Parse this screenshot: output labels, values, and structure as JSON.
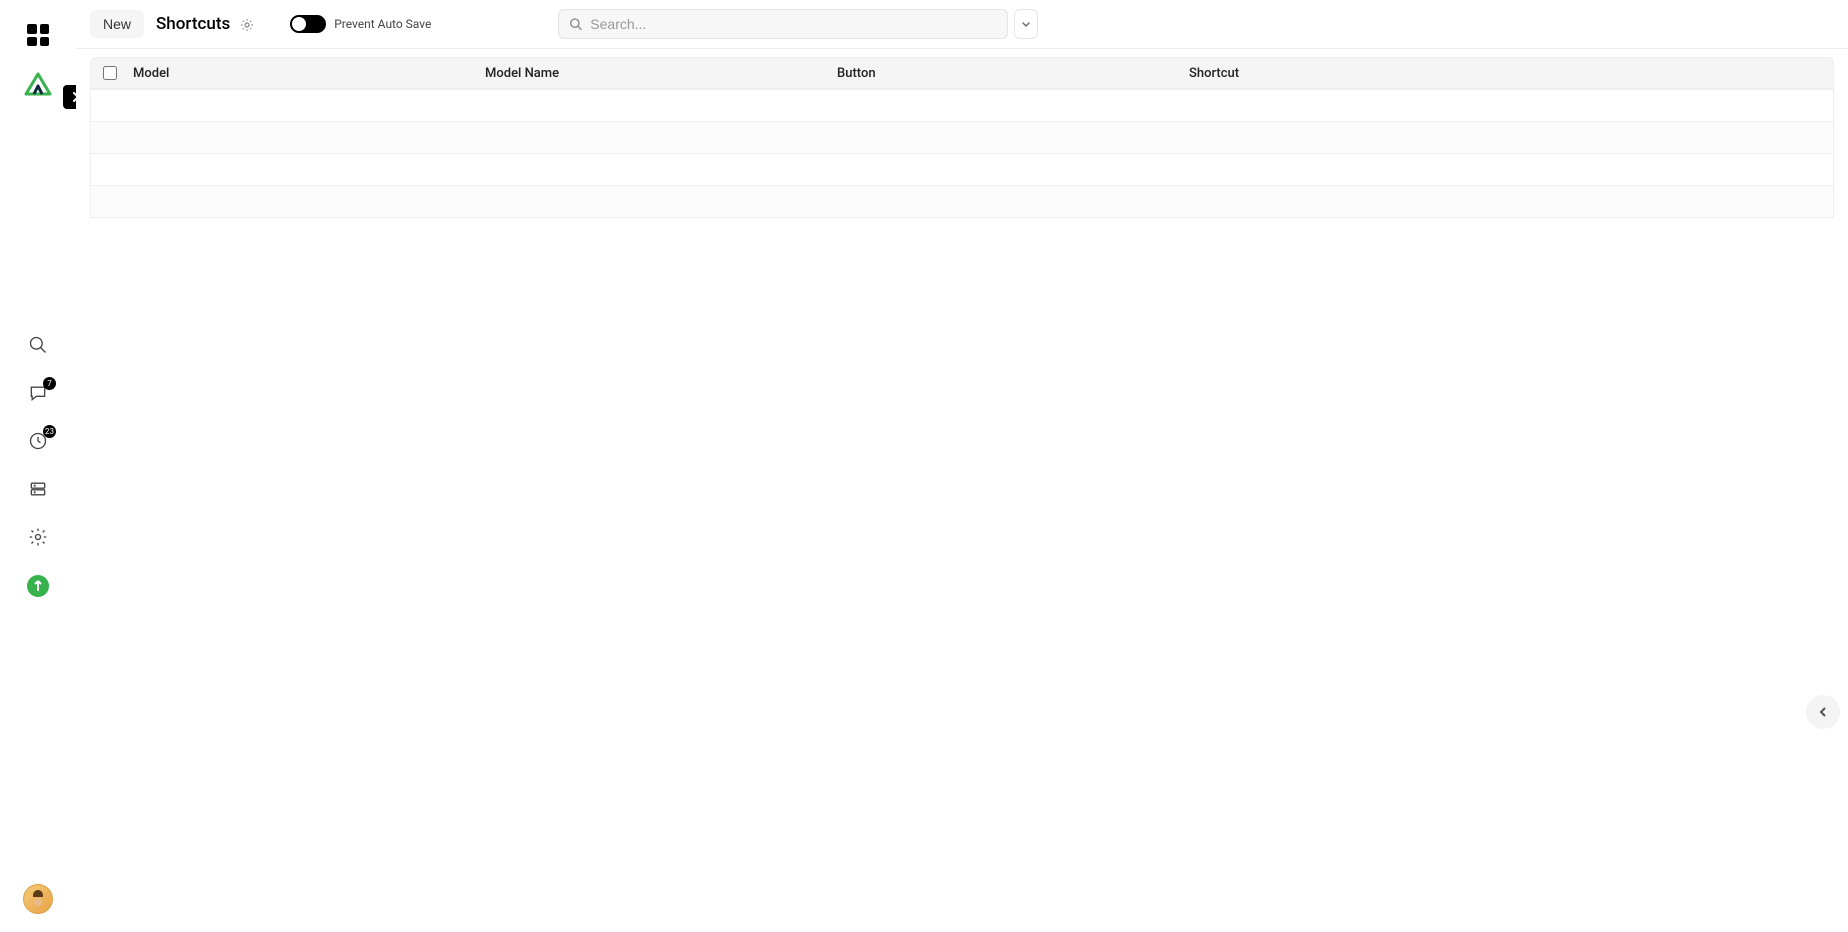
{
  "sidebar": {
    "icons": {
      "apps": "apps",
      "logo": "logo",
      "expand": "chevron-right",
      "search": "search",
      "chat": "chat",
      "clock": "clock",
      "server": "server",
      "gear": "gear",
      "boost": "boost"
    },
    "badges": {
      "chat": "7",
      "clock": "23"
    }
  },
  "topbar": {
    "new_label": "New",
    "title": "Shortcuts",
    "toggle_label": "Prevent Auto Save",
    "toggle_on": false,
    "search_placeholder": "Search..."
  },
  "table": {
    "headers": {
      "model": "Model",
      "model_name": "Model Name",
      "button": "Button",
      "shortcut": "Shortcut"
    },
    "rows": [
      {},
      {},
      {},
      {}
    ]
  }
}
